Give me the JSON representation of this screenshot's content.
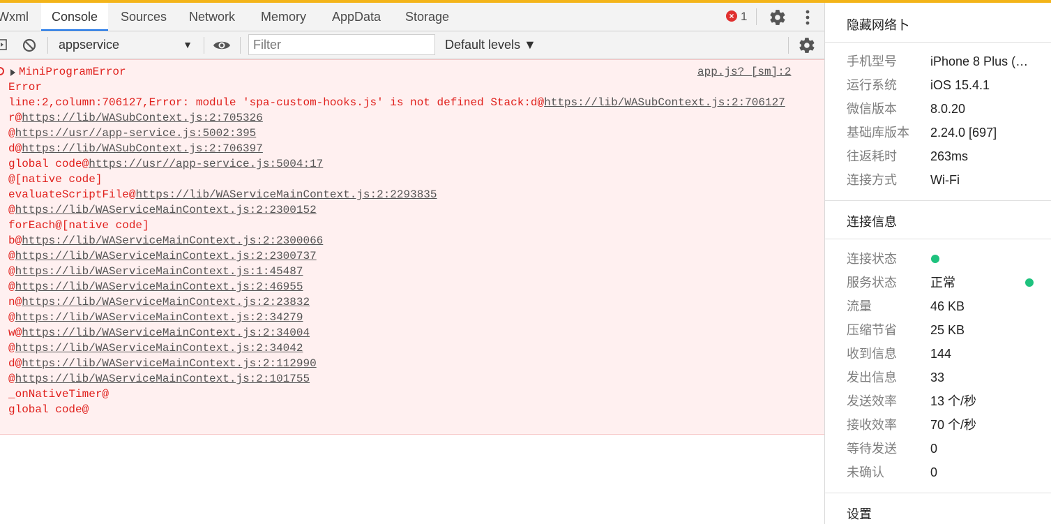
{
  "colors": {
    "accent": "#1a73e8",
    "error_text": "#e0201c",
    "error_bg": "#fff0f0",
    "top_strip": "#f3b419",
    "status_green": "#1ec27e"
  },
  "tabs": [
    {
      "label": "Wxml",
      "active": false
    },
    {
      "label": "Console",
      "active": true
    },
    {
      "label": "Sources",
      "active": false
    },
    {
      "label": "Network",
      "active": false
    },
    {
      "label": "Memory",
      "active": false
    },
    {
      "label": "AppData",
      "active": false
    },
    {
      "label": "Storage",
      "active": false
    }
  ],
  "error_count": "1",
  "toolbar": {
    "context": "appservice",
    "filter_placeholder": "Filter",
    "levels": "Default levels ▼"
  },
  "console": {
    "entry_title": "MiniProgramError",
    "source": "app.js? [sm]:2",
    "lines": [
      {
        "prefix": "Error",
        "link": ""
      },
      {
        "prefix": "line:2,column:706127,Error: module 'spa-custom-hooks.js' is not defined Stack:d@",
        "link": "https://lib/WASubContext.js:2:706127"
      },
      {
        "prefix": "r@",
        "link": "https://lib/WASubContext.js:2:705326"
      },
      {
        "prefix": "@",
        "link": "https://usr//app-service.js:5002:395"
      },
      {
        "prefix": "d@",
        "link": "https://lib/WASubContext.js:2:706397"
      },
      {
        "prefix": "global code@",
        "link": "https://usr//app-service.js:5004:17"
      },
      {
        "prefix": "@[native code]",
        "link": ""
      },
      {
        "prefix": "evaluateScriptFile@",
        "link": "https://lib/WAServiceMainContext.js:2:2293835"
      },
      {
        "prefix": "@",
        "link": "https://lib/WAServiceMainContext.js:2:2300152"
      },
      {
        "prefix": "forEach@[native code]",
        "link": ""
      },
      {
        "prefix": "b@",
        "link": "https://lib/WAServiceMainContext.js:2:2300066"
      },
      {
        "prefix": "@",
        "link": "https://lib/WAServiceMainContext.js:2:2300737"
      },
      {
        "prefix": "@",
        "link": "https://lib/WAServiceMainContext.js:1:45487"
      },
      {
        "prefix": "@",
        "link": "https://lib/WAServiceMainContext.js:2:46955"
      },
      {
        "prefix": "n@",
        "link": "https://lib/WAServiceMainContext.js:2:23832"
      },
      {
        "prefix": "@",
        "link": "https://lib/WAServiceMainContext.js:2:34279"
      },
      {
        "prefix": "w@",
        "link": "https://lib/WAServiceMainContext.js:2:34004"
      },
      {
        "prefix": "@",
        "link": "https://lib/WAServiceMainContext.js:2:34042"
      },
      {
        "prefix": "d@",
        "link": "https://lib/WAServiceMainContext.js:2:112990"
      },
      {
        "prefix": "@",
        "link": "https://lib/WAServiceMainContext.js:2:101755"
      },
      {
        "prefix": "_onNativeTimer@",
        "link": ""
      },
      {
        "prefix": "global code@",
        "link": ""
      }
    ]
  },
  "sidepanel": {
    "title": "隐藏网络卜",
    "device": [
      {
        "label": "手机型号",
        "value": "iPhone 8 Plus (G..."
      },
      {
        "label": "运行系统",
        "value": "iOS 15.4.1"
      },
      {
        "label": "微信版本",
        "value": "8.0.20"
      },
      {
        "label": "基础库版本",
        "value": "2.24.0 [697]"
      },
      {
        "label": "往返耗时",
        "value": "263ms"
      },
      {
        "label": "连接方式",
        "value": "Wi-Fi"
      }
    ],
    "connection_title": "连接信息",
    "connection": [
      {
        "label": "连接状态",
        "value": ""
      },
      {
        "label": "服务状态",
        "value": "正常"
      },
      {
        "label": "流量",
        "value": "46 KB"
      },
      {
        "label": "压缩节省",
        "value": "25 KB"
      },
      {
        "label": "收到信息",
        "value": "144"
      },
      {
        "label": "发出信息",
        "value": "33"
      },
      {
        "label": "发送效率",
        "value": "13 个/秒"
      },
      {
        "label": "接收效率",
        "value": "70 个/秒"
      },
      {
        "label": "等待发送",
        "value": "0"
      },
      {
        "label": "未确认",
        "value": "0"
      }
    ],
    "settings_title": "设置"
  }
}
